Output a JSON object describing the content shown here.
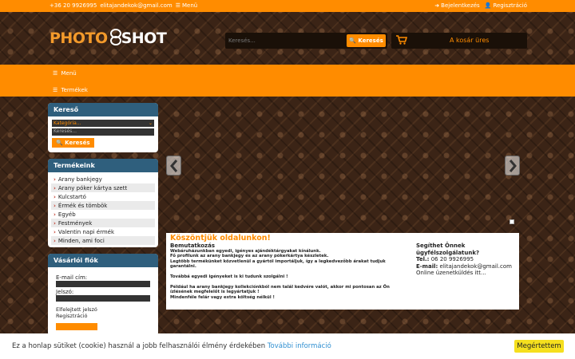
{
  "topbar": {
    "phone": "+36 20 9926995",
    "email": "elitajandekok@gmail.com",
    "menu": "Menü",
    "login": "Bejelentkezés",
    "register": "Regisztráció"
  },
  "logo": {
    "part1": "PHOTO",
    "part2": "8",
    "part3": "SHOT"
  },
  "search": {
    "placeholder": "Keresés...",
    "button": "Keresés"
  },
  "cart": {
    "text": "A kosár üres"
  },
  "navbar": {
    "menu": "Menü",
    "products": "Termékek"
  },
  "sidebar": {
    "kereso": {
      "title": "Kereső",
      "category_value": "Kategória...",
      "input_placeholder": "Keresés...",
      "button": "Keresés"
    },
    "termekeink": {
      "title": "Termékeink",
      "items": [
        {
          "label": "Arany bankjegy"
        },
        {
          "label": "Arany póker kártya szett"
        },
        {
          "label": "Kulcstartó"
        },
        {
          "label": "Érmék és tömbök"
        },
        {
          "label": "Egyéb"
        },
        {
          "label": "Festmények"
        },
        {
          "label": "Valentin napi érmék"
        },
        {
          "label": "Minden, ami foci"
        }
      ]
    },
    "login": {
      "title": "Vásárlói fiók",
      "email_label": "E-mail cím:",
      "password_label": "Jelszó:",
      "forgot": "Elfelejtett jelszó",
      "register": "Regisztráció"
    }
  },
  "welcome": {
    "title": "Köszöntjük oldalunkon!",
    "subtitle": "Bemutatkozás",
    "lines": [
      "Webáruházunkban egyedi, igényes ajándéktárgyakat kínálunk.",
      "Fő profilunk az arany bankjegy és az arany pókerkártya készletek.",
      "Legtöbb termékünket közvetlenül a gyártól importáljuk, így a legkedvezőbb árakat tudjuk garantálni.",
      "",
      "Továbbá egyedi igényeket is ki tudunk szolgálni !",
      "",
      "Például ha arany bankjegy kollekciónkból nem talál kedvére valót, akkor mi pontosan az Ön ízlésének megfelelőt is legyártatjuk !",
      "Mindenféle felár vagy extra költség nélkül !"
    ],
    "contact_title": "Segíthet Önnek ügyfélszolgálatunk?",
    "tel_label": "Tel.:",
    "tel": "06 20 9926995",
    "email_label": "E-mail:",
    "email": "elitajandekok@gmail.com",
    "online": "Online üzenetküldés itt..."
  },
  "cookie": {
    "text": "Ez a honlap sütiket (cookie) használ a jobb felhasználói élmény érdekében",
    "more": "További információ",
    "button": "Megértettem"
  },
  "colors": {
    "accent": "#ff8c00",
    "panel_header": "#2f5f7d",
    "cookie_button": "#f5df1e",
    "link": "#2f8fd1"
  }
}
